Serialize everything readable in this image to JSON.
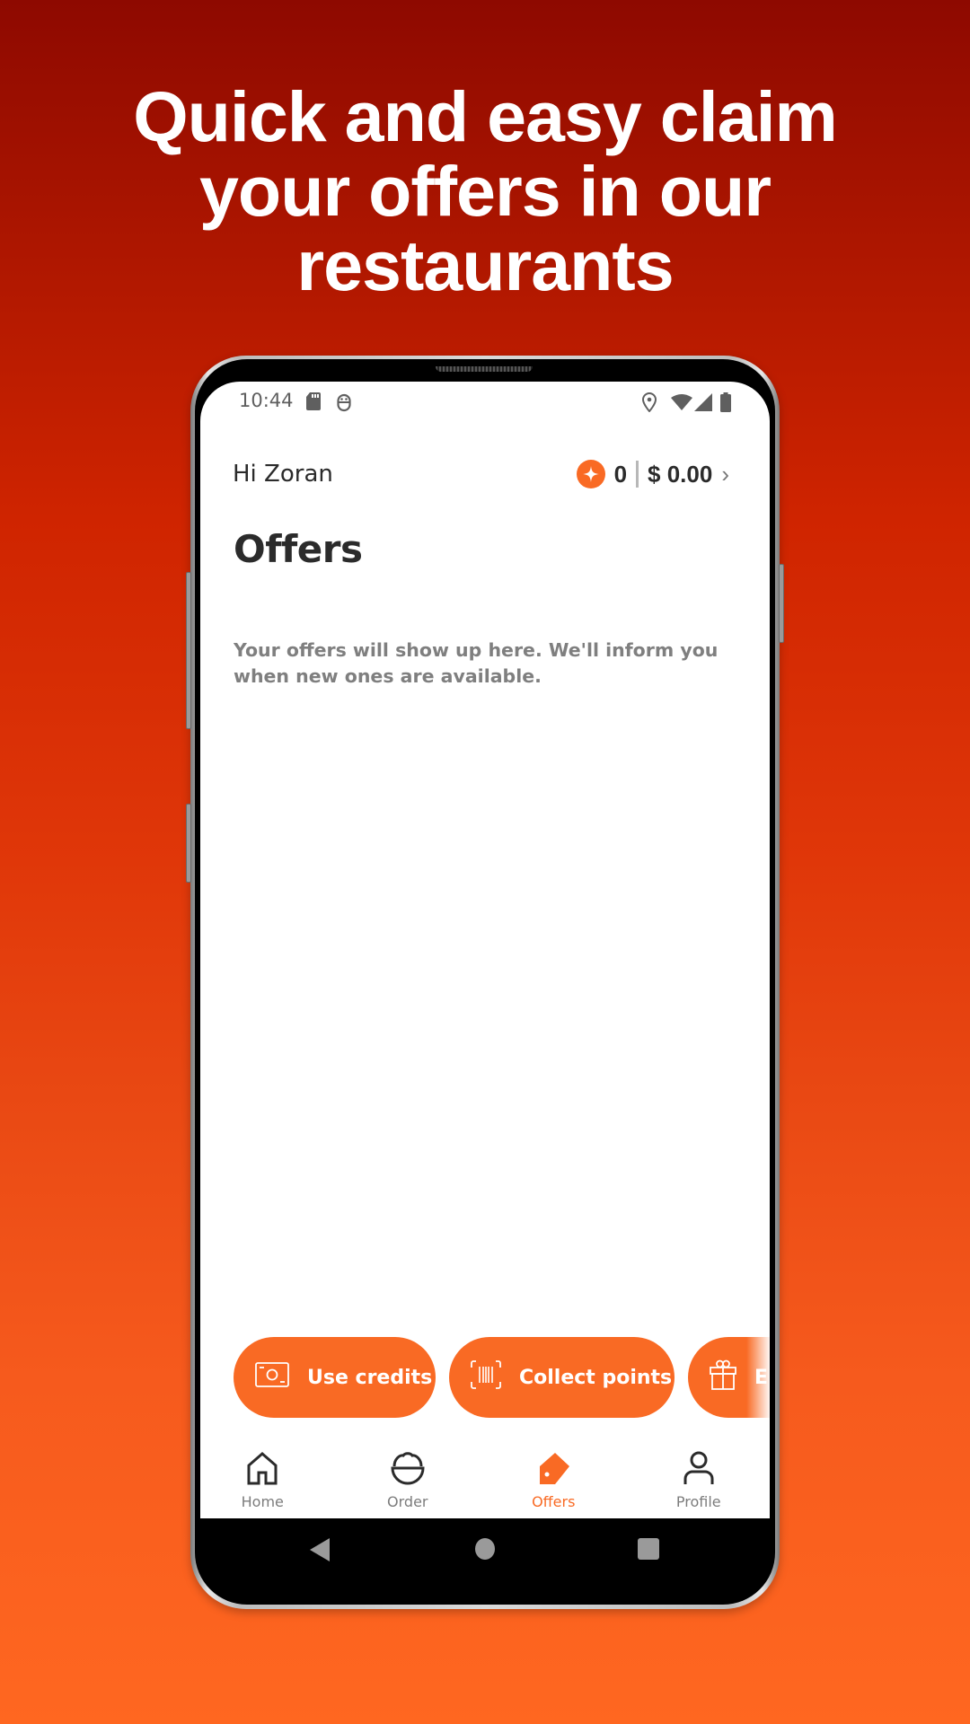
{
  "headline": {
    "lines": [
      "Quick and easy claim",
      "your offers in our",
      "restaurants"
    ]
  },
  "status_bar": {
    "time": "10:44",
    "icons": [
      "sd-card-icon",
      "android-debug-icon",
      "location-icon",
      "wifi-icon",
      "cellular-signal-icon",
      "battery-icon"
    ]
  },
  "header": {
    "greeting": "Hi Zoran",
    "points": "0",
    "credit": "$ 0.00",
    "chevron": "›"
  },
  "page": {
    "title": "Offers",
    "empty_message": "Your offers will show up here. We'll inform you when new ones are available."
  },
  "actions": [
    {
      "label": "Use credits",
      "icon": "cash-icon"
    },
    {
      "label": "Collect points",
      "icon": "barcode-scan-icon"
    },
    {
      "label": "E",
      "icon": "gift-icon"
    }
  ],
  "tabs": [
    {
      "label": "Home",
      "icon": "home-icon",
      "active": false
    },
    {
      "label": "Order",
      "icon": "bowl-icon",
      "active": false
    },
    {
      "label": "Offers",
      "icon": "tag-icon",
      "active": true
    },
    {
      "label": "Profile",
      "icon": "person-icon",
      "active": false
    }
  ],
  "colors": {
    "accent": "#f96a24",
    "text_dark": "#2b2b2b",
    "text_muted": "#7f7f7f",
    "bg_top": "#8e0900",
    "bg_bottom": "#ff6720"
  }
}
